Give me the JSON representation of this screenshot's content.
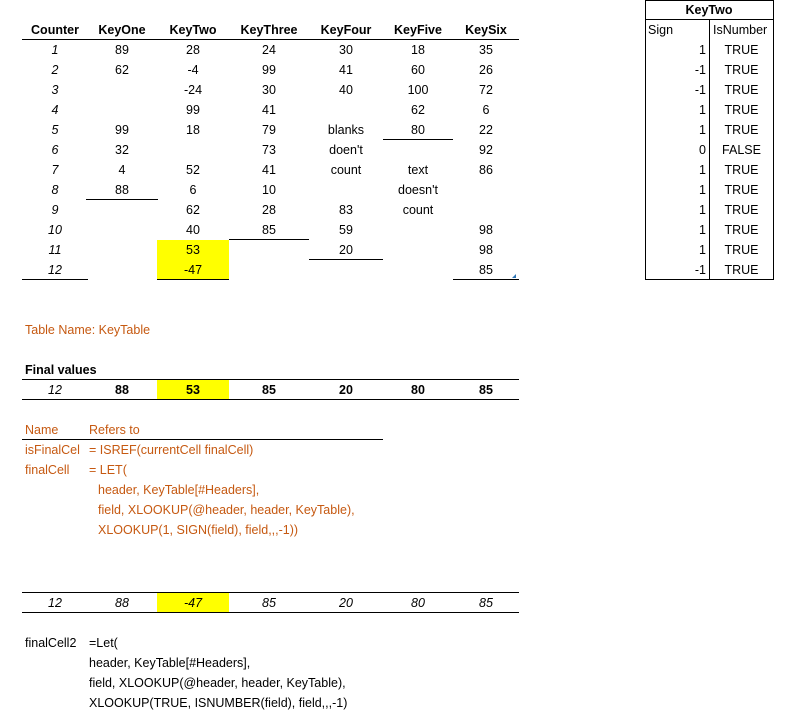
{
  "key_table": {
    "headers": [
      "Counter",
      "KeyOne",
      "KeyTwo",
      "KeyThree",
      "KeyFour",
      "KeyFive",
      "KeySix"
    ],
    "rows": [
      [
        "1",
        "89",
        "28",
        "24",
        "30",
        "18",
        "35"
      ],
      [
        "2",
        "62",
        "-4",
        "99",
        "41",
        "60",
        "26"
      ],
      [
        "3",
        "",
        "-24",
        "30",
        "40",
        "100",
        "72"
      ],
      [
        "4",
        "",
        "99",
        "41",
        "",
        "62",
        "6"
      ],
      [
        "5",
        "99",
        "18",
        "79",
        "blanks",
        "80",
        "22"
      ],
      [
        "6",
        "32",
        "",
        "73",
        "doen't",
        "",
        "92"
      ],
      [
        "7",
        "4",
        "52",
        "41",
        "count",
        "text",
        "86"
      ],
      [
        "8",
        "88",
        "6",
        "10",
        "",
        "doesn't",
        ""
      ],
      [
        "9",
        "",
        "62",
        "28",
        "83",
        "count",
        ""
      ],
      [
        "10",
        "",
        "40",
        "85",
        "59",
        "",
        "98"
      ],
      [
        "11",
        "",
        "53",
        "",
        "20",
        "",
        "98"
      ],
      [
        "12",
        "",
        "-47",
        "",
        "",
        "",
        "85"
      ]
    ],
    "highlight_color": "#ffff00"
  },
  "side_table": {
    "title": "KeyTwo",
    "headers": [
      "Sign",
      "IsNumber"
    ],
    "rows": [
      [
        "1",
        "TRUE"
      ],
      [
        "-1",
        "TRUE"
      ],
      [
        "-1",
        "TRUE"
      ],
      [
        "1",
        "TRUE"
      ],
      [
        "1",
        "TRUE"
      ],
      [
        "0",
        "FALSE"
      ],
      [
        "1",
        "TRUE"
      ],
      [
        "1",
        "TRUE"
      ],
      [
        "1",
        "TRUE"
      ],
      [
        "1",
        "TRUE"
      ],
      [
        "1",
        "TRUE"
      ],
      [
        "-1",
        "TRUE"
      ]
    ]
  },
  "table_name_label": "Table Name: KeyTable",
  "final_values": {
    "title": "Final values",
    "values": [
      "12",
      "88",
      "53",
      "85",
      "20",
      "80",
      "85"
    ]
  },
  "names": {
    "col_name": "Name",
    "col_refers": "Refers to",
    "rows": [
      {
        "name": "isFinalCel",
        "formula": "= ISREF(currentCell finalCell)"
      },
      {
        "name": "finalCell",
        "formula": "= LET("
      }
    ],
    "continuation": [
      "header, KeyTable[#Headers],",
      "field, XLOOKUP(@header, header, KeyTable),",
      "XLOOKUP(1, SIGN(field), field,,,-1))"
    ],
    "text_color": "#c65911"
  },
  "final_values_2": {
    "values": [
      "12",
      "88",
      "-47",
      "85",
      "20",
      "80",
      "85"
    ]
  },
  "final_cell2": {
    "name": "finalCell2",
    "first": "=Let(",
    "lines": [
      "header, KeyTable[#Headers],",
      "field, XLOOKUP(@header, header, KeyTable),",
      "XLOOKUP(TRUE, ISNUMBER(field), field,,,-1)"
    ]
  }
}
